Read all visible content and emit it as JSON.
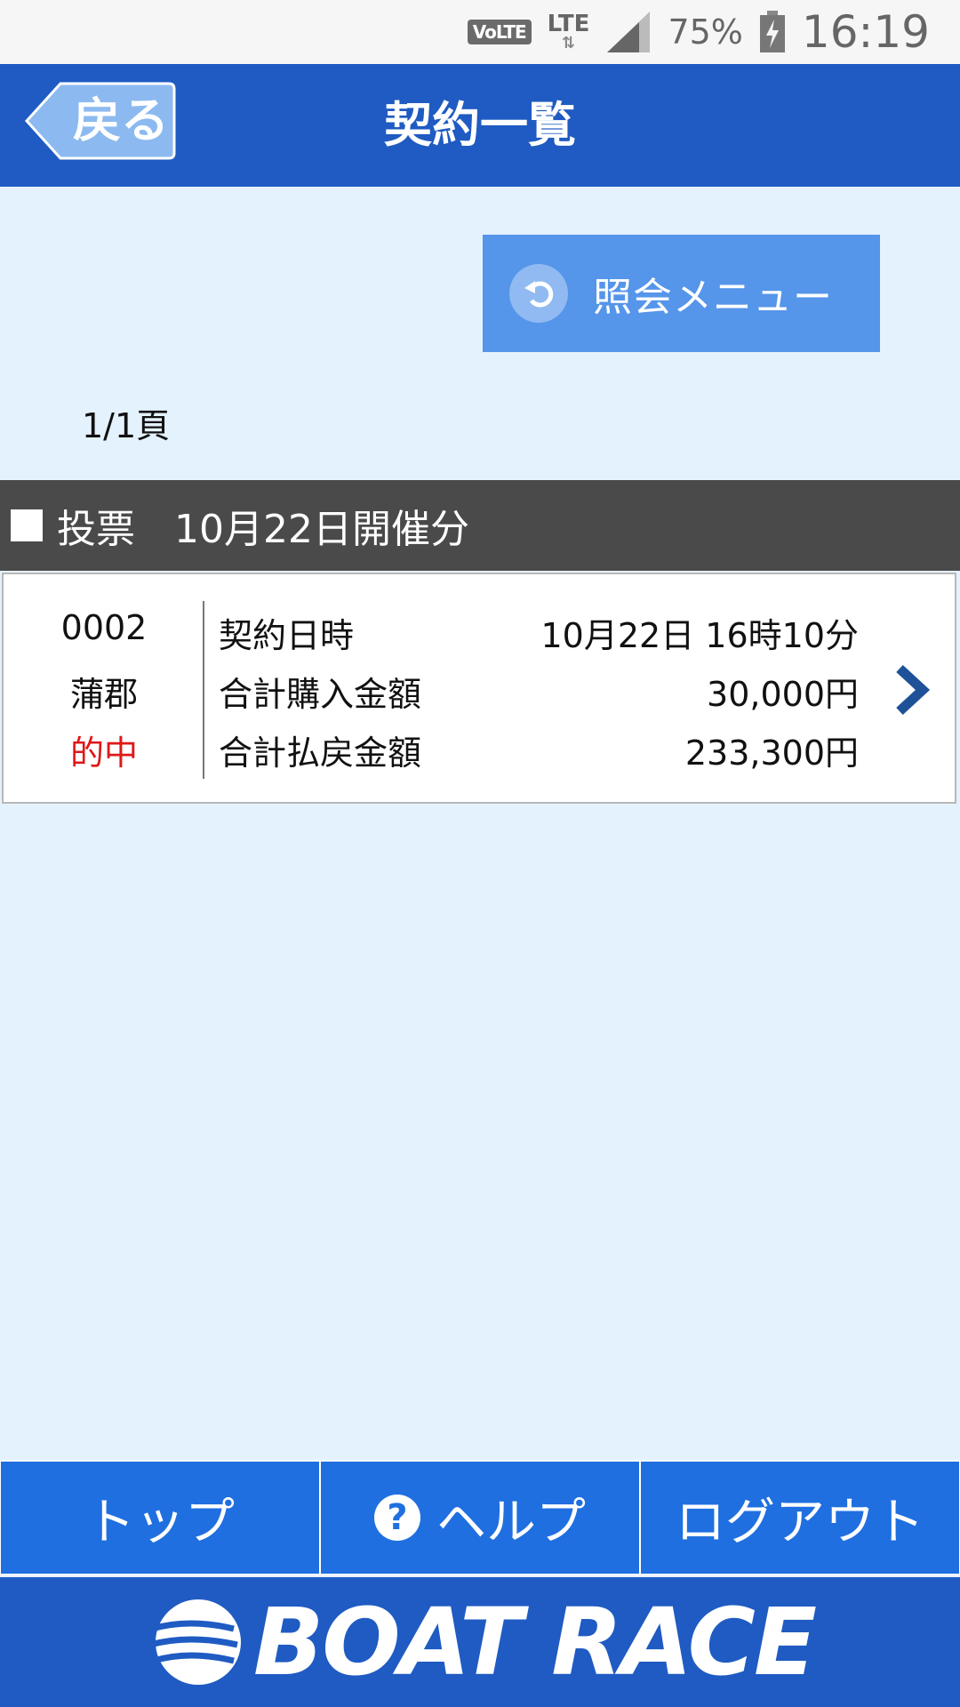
{
  "status_bar": {
    "volte": "VoLTE",
    "network": "LTE",
    "battery_percent": "75%",
    "time": "16:19"
  },
  "header": {
    "back_label": "戻る",
    "title": "契約一覧"
  },
  "menu_button": {
    "label": "照会メニュー"
  },
  "page_indicator": "1/1頁",
  "section": {
    "title": "投票　10月22日開催分"
  },
  "contract": {
    "number": "0002",
    "venue": "蒲郡",
    "result": "的中",
    "rows": [
      {
        "label": "契約日時",
        "value": "10月22日 16時10分"
      },
      {
        "label": "合計購入金額",
        "value": "30,000円"
      },
      {
        "label": "合計払戻金額",
        "value": "233,300円"
      }
    ]
  },
  "bottom_nav": {
    "top": "トップ",
    "help": "ヘルプ",
    "logout": "ログアウト"
  },
  "footer": {
    "logo": "BOAT RACE"
  },
  "colors": {
    "header_blue": "#1f5bc2",
    "nav_blue": "#1f6fe0",
    "menu_button": "#5595ea",
    "background": "#e4f2fd",
    "hit_red": "#e01818"
  }
}
